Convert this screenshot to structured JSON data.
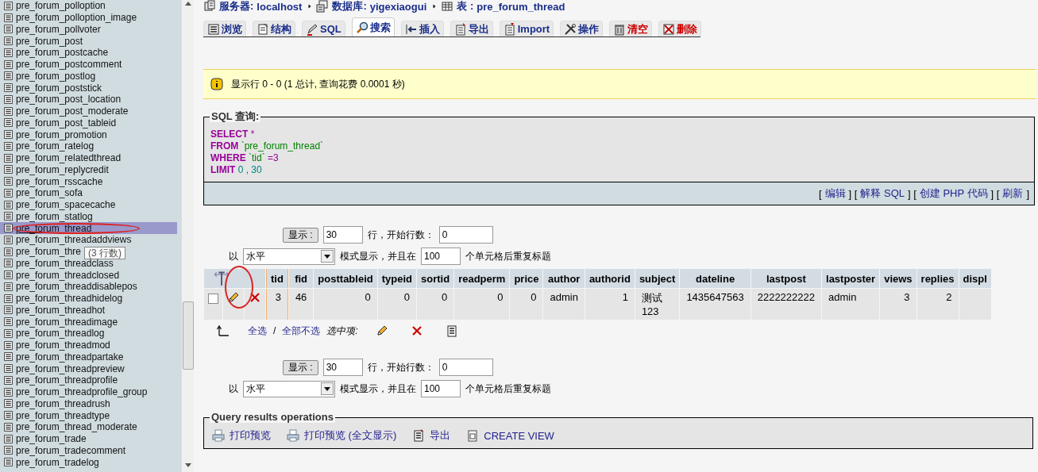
{
  "sidebar": {
    "items": [
      {
        "label": "pre_forum_polloption",
        "selected": false
      },
      {
        "label": "pre_forum_polloption_image",
        "selected": false
      },
      {
        "label": "pre_forum_pollvoter",
        "selected": false
      },
      {
        "label": "pre_forum_post",
        "selected": false
      },
      {
        "label": "pre_forum_postcache",
        "selected": false
      },
      {
        "label": "pre_forum_postcomment",
        "selected": false
      },
      {
        "label": "pre_forum_postlog",
        "selected": false
      },
      {
        "label": "pre_forum_poststick",
        "selected": false
      },
      {
        "label": "pre_forum_post_location",
        "selected": false
      },
      {
        "label": "pre_forum_post_moderate",
        "selected": false
      },
      {
        "label": "pre_forum_post_tableid",
        "selected": false
      },
      {
        "label": "pre_forum_promotion",
        "selected": false
      },
      {
        "label": "pre_forum_ratelog",
        "selected": false
      },
      {
        "label": "pre_forum_relatedthread",
        "selected": false
      },
      {
        "label": "pre_forum_replycredit",
        "selected": false
      },
      {
        "label": "pre_forum_rsscache",
        "selected": false
      },
      {
        "label": "pre_forum_sofa",
        "selected": false
      },
      {
        "label": "pre_forum_spacecache",
        "selected": false
      },
      {
        "label": "pre_forum_statlog",
        "selected": false
      },
      {
        "label": "pre_forum_thread",
        "selected": true
      },
      {
        "label": "pre_forum_threadaddviews",
        "selected": false
      },
      {
        "label": "pre_forum_thre",
        "selected": false,
        "tooltip": "(3 行数)"
      },
      {
        "label": "pre_forum_threadclass",
        "selected": false
      },
      {
        "label": "pre_forum_threadclosed",
        "selected": false
      },
      {
        "label": "pre_forum_threaddisablepos",
        "selected": false
      },
      {
        "label": "pre_forum_threadhidelog",
        "selected": false
      },
      {
        "label": "pre_forum_threadhot",
        "selected": false
      },
      {
        "label": "pre_forum_threadimage",
        "selected": false
      },
      {
        "label": "pre_forum_threadlog",
        "selected": false
      },
      {
        "label": "pre_forum_threadmod",
        "selected": false
      },
      {
        "label": "pre_forum_threadpartake",
        "selected": false
      },
      {
        "label": "pre_forum_threadpreview",
        "selected": false
      },
      {
        "label": "pre_forum_threadprofile",
        "selected": false
      },
      {
        "label": "pre_forum_threadprofile_group",
        "selected": false
      },
      {
        "label": "pre_forum_threadrush",
        "selected": false
      },
      {
        "label": "pre_forum_threadtype",
        "selected": false
      },
      {
        "label": "pre_forum_thread_moderate",
        "selected": false
      },
      {
        "label": "pre_forum_trade",
        "selected": false
      },
      {
        "label": "pre_forum_tradecomment",
        "selected": false
      },
      {
        "label": "pre_forum_tradelog",
        "selected": false
      }
    ]
  },
  "breadcrumb": [
    {
      "label": "服务器:",
      "value": "localhost"
    },
    {
      "label": "数据库:",
      "value": "yigexiaogui"
    },
    {
      "label": "表 :",
      "value": "pre_forum_thread"
    }
  ],
  "tabs": [
    {
      "label": "浏览",
      "selected": false,
      "kind": "normal"
    },
    {
      "label": "结构",
      "selected": false,
      "kind": "normal"
    },
    {
      "label": "SQL",
      "selected": false,
      "kind": "normal"
    },
    {
      "label": "搜索",
      "selected": true,
      "kind": "normal"
    },
    {
      "label": "插入",
      "selected": false,
      "kind": "normal"
    },
    {
      "label": "导出",
      "selected": false,
      "kind": "normal"
    },
    {
      "label": "Import",
      "selected": false,
      "kind": "normal"
    },
    {
      "label": "操作",
      "selected": false,
      "kind": "normal"
    },
    {
      "label": "清空",
      "selected": false,
      "kind": "danger"
    },
    {
      "label": "删除",
      "selected": false,
      "kind": "danger"
    }
  ],
  "notice": "显示行 0 - 0 (1 总计, 查询花费 0.0001 秒)",
  "sql_query": {
    "legend": "SQL 查询:",
    "lines": [
      [
        {
          "text": "SELECT",
          "kind": "keyword"
        },
        {
          "text": " *",
          "kind": "operator"
        }
      ],
      [
        {
          "text": "FROM",
          "kind": "keyword"
        },
        {
          "text": " `pre_forum_thread`",
          "kind": "identifier"
        }
      ],
      [
        {
          "text": "WHERE",
          "kind": "keyword"
        },
        {
          "text": " `tid`",
          "kind": "identifier"
        },
        {
          "text": " =3",
          "kind": "operator"
        }
      ],
      [
        {
          "text": "LIMIT",
          "kind": "keyword"
        },
        {
          "text": " 0 , 30",
          "kind": "number"
        }
      ]
    ],
    "links": [
      {
        "kind": "text",
        "text": "["
      },
      {
        "kind": "link",
        "text": "编辑"
      },
      {
        "kind": "text",
        "text": "] ["
      },
      {
        "kind": "link",
        "text": "解释 SQL"
      },
      {
        "kind": "text",
        "text": "] ["
      },
      {
        "kind": "link",
        "text": "创建 PHP 代码"
      },
      {
        "kind": "text",
        "text": "] ["
      },
      {
        "kind": "link",
        "text": "刷新"
      },
      {
        "kind": "text",
        "text": "]"
      }
    ]
  },
  "navigation_top": {
    "show_button": "显示 :",
    "rows": "30",
    "rows_label": "行，开始行数：",
    "start": "0",
    "mode_prefix": "以",
    "mode": "水平",
    "mode_label": "模式显示，并且在",
    "repeat": "100",
    "repeat_label": "个单元格后重复标题"
  },
  "table": {
    "columns": [
      {
        "label": "tid",
        "kind": "number",
        "highlighted": true
      },
      {
        "label": "fid",
        "kind": "number",
        "highlighted": false
      },
      {
        "label": "posttableid",
        "kind": "number",
        "highlighted": false
      },
      {
        "label": "typeid",
        "kind": "number",
        "highlighted": false
      },
      {
        "label": "sortid",
        "kind": "number",
        "highlighted": false
      },
      {
        "label": "readperm",
        "kind": "number",
        "highlighted": false
      },
      {
        "label": "price",
        "kind": "number",
        "highlighted": false
      },
      {
        "label": "author",
        "kind": "text",
        "highlighted": false
      },
      {
        "label": "authorid",
        "kind": "number",
        "highlighted": false
      },
      {
        "label": "subject",
        "kind": "text",
        "highlighted": false
      },
      {
        "label": "dateline",
        "kind": "text",
        "highlighted": false
      },
      {
        "label": "lastpost",
        "kind": "text",
        "highlighted": false
      },
      {
        "label": "lastposter",
        "kind": "text",
        "highlighted": false
      },
      {
        "label": "views",
        "kind": "number",
        "highlighted": false
      },
      {
        "label": "replies",
        "kind": "number",
        "highlighted": false
      },
      {
        "label": "displ",
        "kind": "number",
        "highlighted": false
      }
    ],
    "rows": [
      {
        "checked": false,
        "cells": [
          "3",
          "46",
          "0",
          "0",
          "0",
          "0",
          "0",
          "admin",
          "1",
          "测试\n123",
          "1435647563",
          "2222222222",
          "admin",
          "3",
          "2",
          ""
        ]
      }
    ]
  },
  "with_selected": {
    "check_all": "全选",
    "separator": "/",
    "uncheck_all": "全部不选",
    "label": "选中项:"
  },
  "navigation_bottom": {
    "show_button": "显示 :",
    "rows": "30",
    "rows_label": "行，开始行数：",
    "start": "0",
    "mode_prefix": "以",
    "mode": "水平",
    "mode_label": "模式显示，并且在",
    "repeat": "100",
    "repeat_label": "个单元格后重复标题"
  },
  "query_results_operations": {
    "legend": "Query results operations",
    "items": [
      {
        "label": "打印预览"
      },
      {
        "label": "打印预览 (全文显示)"
      },
      {
        "label": "导出"
      },
      {
        "label": "CREATE VIEW"
      }
    ]
  }
}
